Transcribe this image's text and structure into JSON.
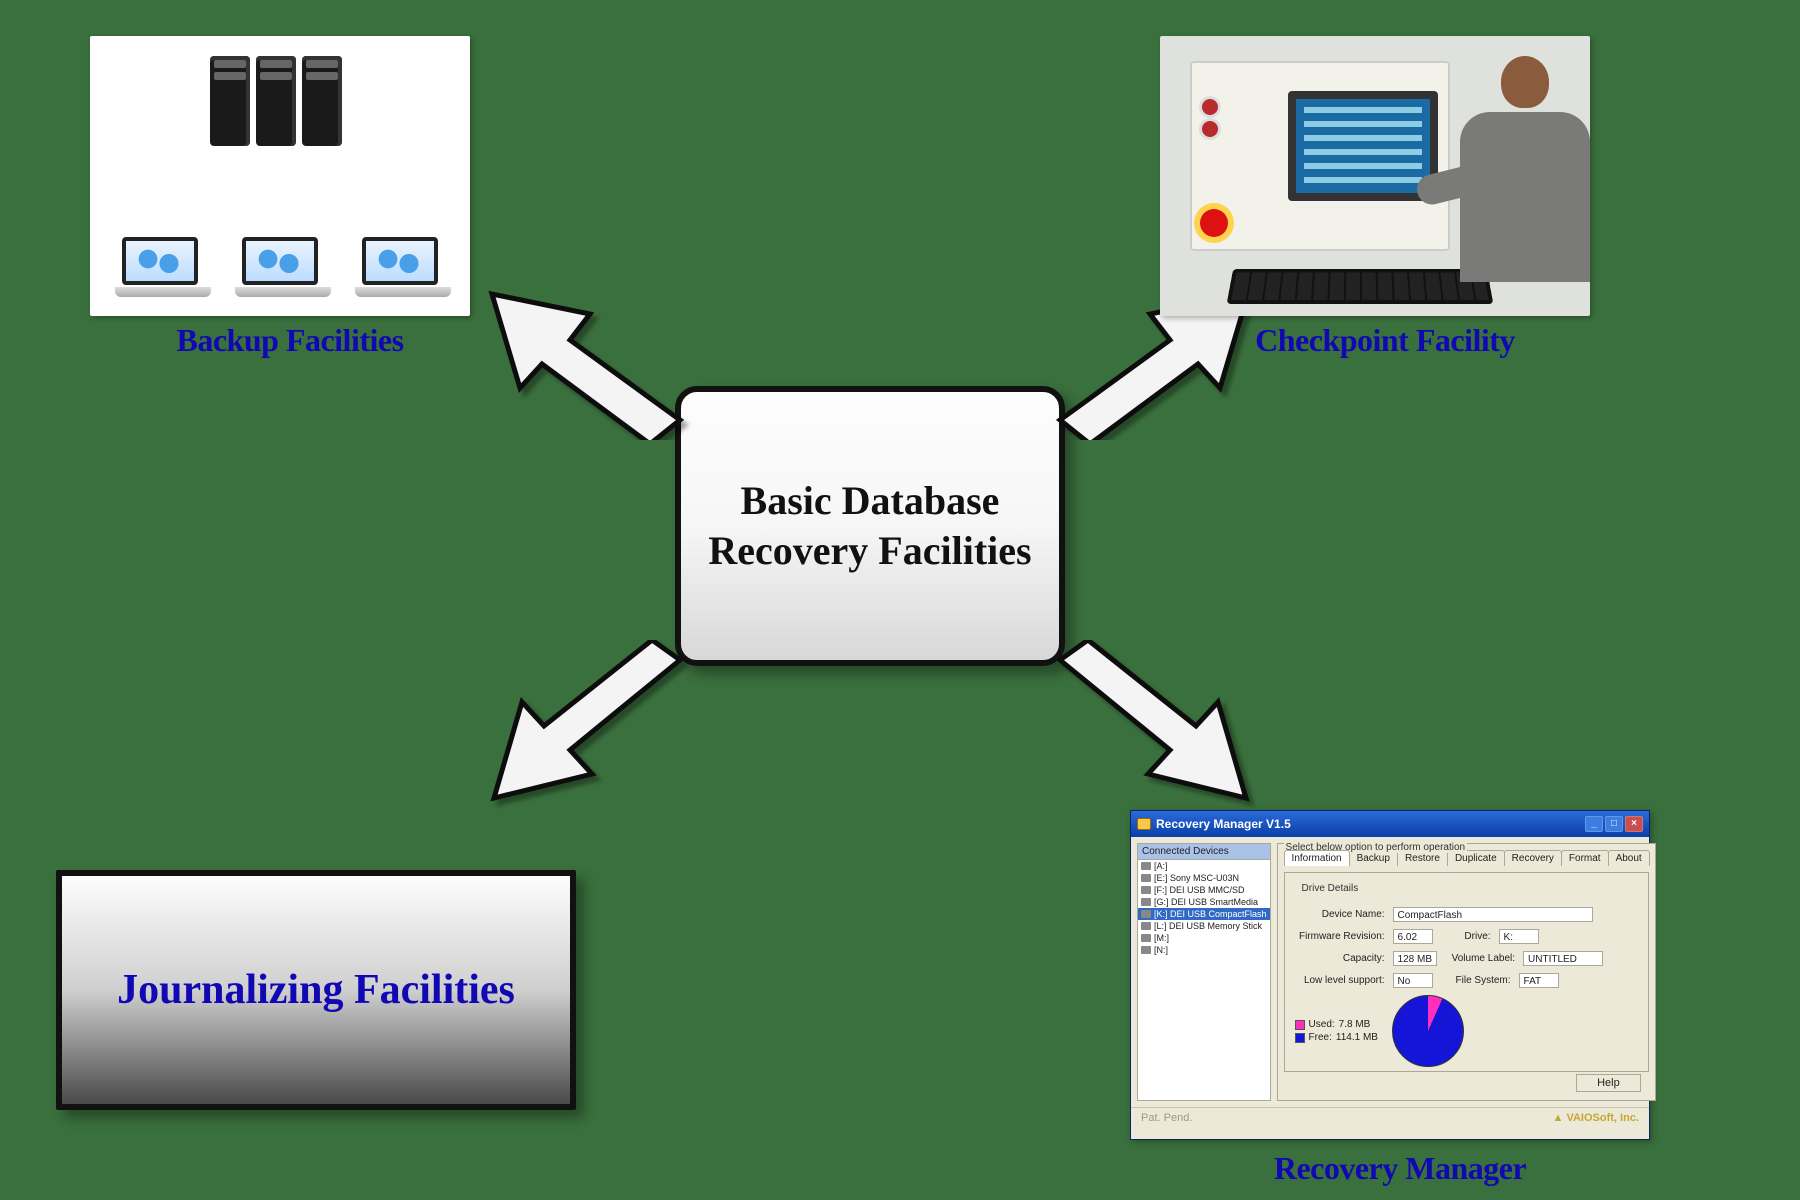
{
  "center": {
    "title": "Basic Database Recovery Facilities"
  },
  "nodes": {
    "backup": {
      "label": "Backup Facilities"
    },
    "checkpoint": {
      "label": "Checkpoint Facility"
    },
    "journal": {
      "label": "Journalizing Facilities"
    },
    "recovery": {
      "label": "Recovery Manager"
    }
  },
  "recovery_window": {
    "title": "Recovery Manager V1.5",
    "connected_header": "Connected Devices",
    "instruction": "Select below option to perform operation",
    "devices": [
      "[A:]",
      "[E:] Sony   MSC-U03N",
      "[F:] DEI USB  MMC/SD",
      "[G:] DEI USB  SmartMedia",
      "[K:] DEI USB  CompactFlash",
      "[L:] DEI USB  Memory Stick",
      "[M:]",
      "[N:]"
    ],
    "selected_index": 4,
    "tabs": [
      "Information",
      "Backup",
      "Restore",
      "Duplicate",
      "Recovery",
      "Format",
      "About"
    ],
    "active_tab": 0,
    "group_title": "Drive Details",
    "fields": {
      "device_name_label": "Device Name:",
      "device_name": "CompactFlash",
      "firmware_label": "Firmware Revision:",
      "firmware": "6.02",
      "drive_label": "Drive:",
      "drive": "K:",
      "capacity_label": "Capacity:",
      "capacity": "128 MB",
      "volume_label_label": "Volume Label:",
      "volume_label": "UNTITLED",
      "lowlevel_label": "Low level support:",
      "lowlevel": "No",
      "filesystem_label": "File System:",
      "filesystem": "FAT"
    },
    "legend": {
      "used_label": "Used:",
      "used_value": "7.8 MB",
      "free_label": "Free:",
      "free_value": "114.1 MB"
    },
    "help_button": "Help",
    "footer_left": "Pat. Pend.",
    "footer_right": "VAIOSoft, Inc."
  }
}
